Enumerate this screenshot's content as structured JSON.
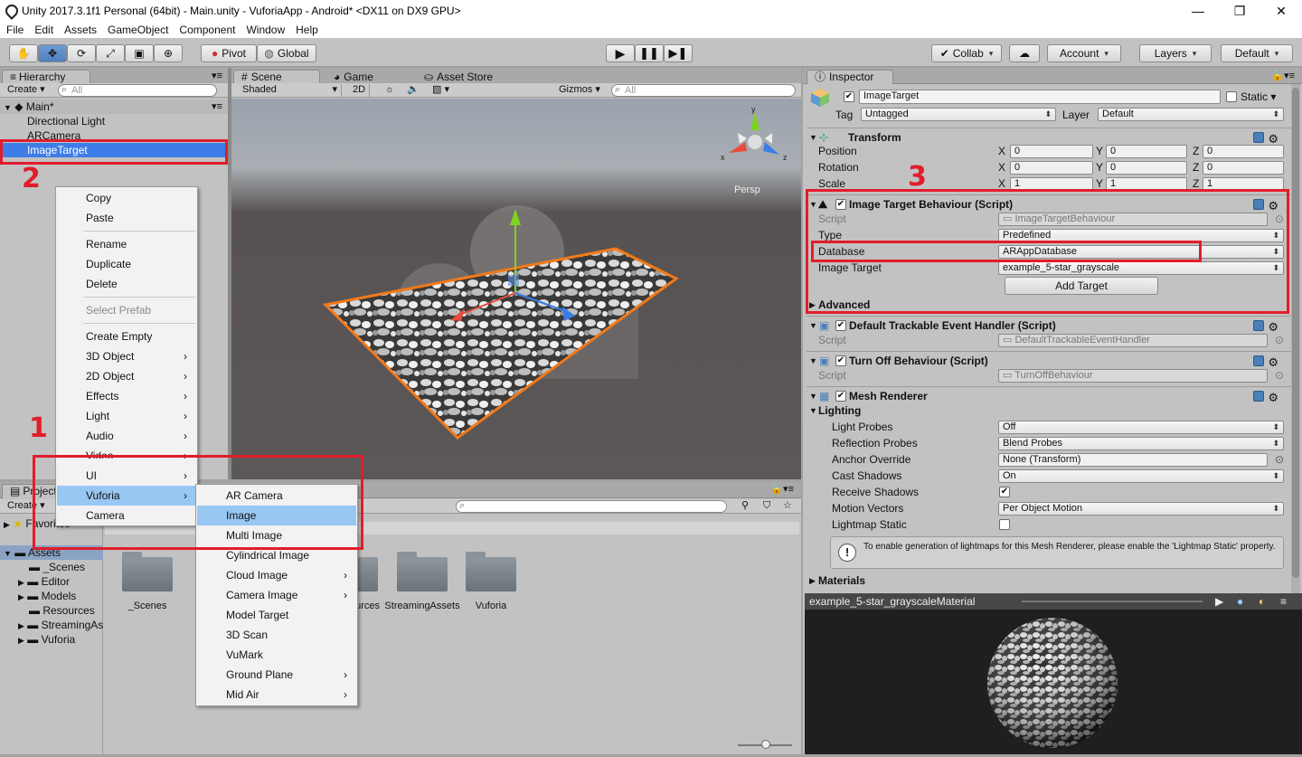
{
  "window": {
    "title": "Unity 2017.3.1f1 Personal (64bit) - Main.unity - VuforiaApp - Android* <DX11 on DX9 GPU>"
  },
  "menubar": [
    "File",
    "Edit",
    "Assets",
    "GameObject",
    "Component",
    "Window",
    "Help"
  ],
  "toolbar": {
    "pivot": "Pivot",
    "global": "Global",
    "collab": "Collab",
    "account": "Account",
    "layers": "Layers",
    "layout": "Default"
  },
  "hierarchy": {
    "tab": "Hierarchy",
    "create": "Create",
    "search_placeholder": "All",
    "scene": "Main*",
    "items": [
      "Directional Light",
      "ARCamera",
      "ImageTarget"
    ]
  },
  "scene_tabs": {
    "scene": "Scene",
    "game": "Game",
    "asset_store": "Asset Store"
  },
  "scene_bar": {
    "shading": "Shaded",
    "mode2d": "2D",
    "gizmos": "Gizmos",
    "search_placeholder": "All",
    "persp": "Persp"
  },
  "context_menu": {
    "items": [
      "Copy",
      "Paste",
      "Rename",
      "Duplicate",
      "Delete",
      "Select Prefab",
      "Create Empty",
      "3D Object",
      "2D Object",
      "Effects",
      "Light",
      "Audio",
      "Video",
      "UI",
      "Vuforia",
      "Camera"
    ]
  },
  "vuforia_menu": {
    "items": [
      "AR Camera",
      "Image",
      "Multi Image",
      "Cylindrical Image",
      "Cloud Image",
      "Camera Image",
      "Model Target",
      "3D Scan",
      "VuMark",
      "Ground Plane",
      "Mid Air"
    ]
  },
  "project": {
    "tab": "Project",
    "create": "Create",
    "favorites": "Favorites",
    "tree": [
      "Assets",
      "_Scenes",
      "Editor",
      "Models",
      "Resources",
      "StreamingAssets",
      "Vuforia"
    ],
    "folders": [
      "_Scenes",
      "Resources",
      "StreamingAssets",
      "Vuforia"
    ]
  },
  "inspector": {
    "tab": "Inspector",
    "object_name": "ImageTarget",
    "static_label": "Static",
    "tag_label": "Tag",
    "tag": "Untagged",
    "layer_label": "Layer",
    "layer": "Default",
    "transform": {
      "title": "Transform",
      "position": {
        "label": "Position",
        "x": "0",
        "y": "0",
        "z": "0"
      },
      "rotation": {
        "label": "Rotation",
        "x": "0",
        "y": "0",
        "z": "0"
      },
      "scale": {
        "label": "Scale",
        "x": "1",
        "y": "1",
        "z": "1"
      }
    },
    "image_target_behaviour": {
      "title": "Image Target Behaviour (Script)",
      "script_label": "Script",
      "script": "ImageTargetBehaviour",
      "type_label": "Type",
      "type": "Predefined",
      "database_label": "Database",
      "database": "ARAppDatabase",
      "image_target_label": "Image Target",
      "image_target": "example_5-star_grayscale",
      "add_target": "Add Target",
      "advanced": "Advanced"
    },
    "default_handler": {
      "title": "Default Trackable Event Handler (Script)",
      "script_label": "Script",
      "script": "DefaultTrackableEventHandler"
    },
    "turn_off": {
      "title": "Turn Off Behaviour (Script)",
      "script_label": "Script",
      "script": "TurnOffBehaviour"
    },
    "mesh_renderer": {
      "title": "Mesh Renderer",
      "lighting": "Lighting",
      "light_probes_label": "Light Probes",
      "light_probes": "Off",
      "reflection_probes_label": "Reflection Probes",
      "reflection_probes": "Blend Probes",
      "anchor_override_label": "Anchor Override",
      "anchor_override": "None (Transform)",
      "cast_shadows_label": "Cast Shadows",
      "cast_shadows": "On",
      "receive_shadows_label": "Receive Shadows",
      "motion_vectors_label": "Motion Vectors",
      "motion_vectors": "Per Object Motion",
      "lightmap_static_label": "Lightmap Static",
      "info": "To enable generation of lightmaps for this Mesh Renderer, please enable the 'Lightmap Static' property.",
      "materials": "Materials"
    },
    "preview_title": "example_5-star_grayscaleMaterial"
  },
  "annotations": {
    "one": "1",
    "two": "2",
    "three": "3",
    "accent": "#e21d2b"
  }
}
